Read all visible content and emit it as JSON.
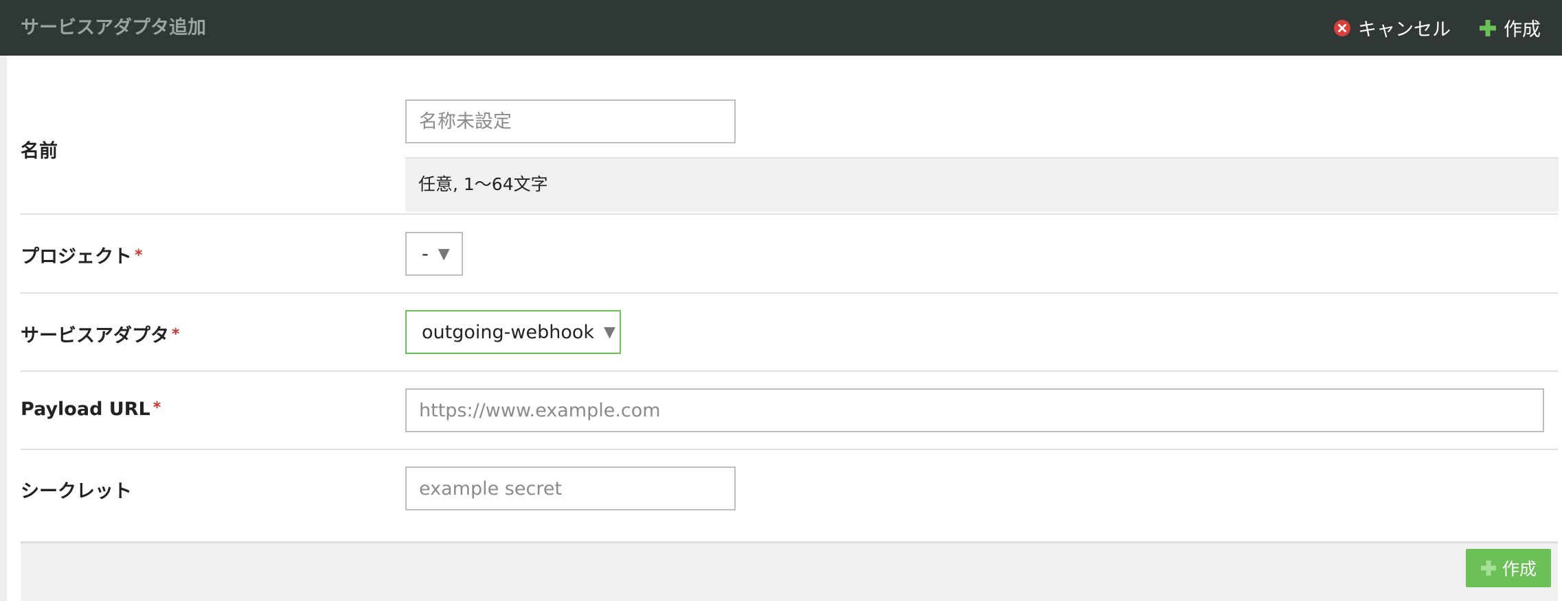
{
  "header": {
    "title": "サービスアダプタ追加",
    "cancel_label": "キャンセル",
    "create_label": "作成",
    "cancel_icon": "close-circle-icon",
    "create_icon": "plus-icon"
  },
  "form": {
    "name": {
      "label": "名前",
      "placeholder": "名称未設定",
      "hint": "任意, 1〜64文字"
    },
    "project": {
      "label": "プロジェクト",
      "required_mark": "*",
      "selected": "-"
    },
    "service_adapter": {
      "label": "サービスアダプタ",
      "required_mark": "*",
      "selected": "outgoing-webhook"
    },
    "payload_url": {
      "label": "Payload URL",
      "required_mark": "*",
      "placeholder": "https://www.example.com"
    },
    "secret": {
      "label": "シークレット",
      "placeholder": "example secret"
    }
  },
  "footer": {
    "create_label": "作成"
  },
  "colors": {
    "header_bg": "#2f3836",
    "accent_green": "#6cc058",
    "required_red": "#d2322d",
    "cancel_red": "#d9403a"
  }
}
